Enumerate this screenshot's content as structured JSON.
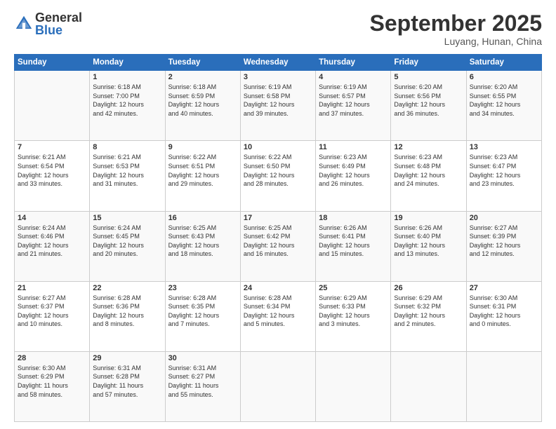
{
  "logo": {
    "general": "General",
    "blue": "Blue"
  },
  "header": {
    "month": "September 2025",
    "location": "Luyang, Hunan, China"
  },
  "weekdays": [
    "Sunday",
    "Monday",
    "Tuesday",
    "Wednesday",
    "Thursday",
    "Friday",
    "Saturday"
  ],
  "weeks": [
    [
      {
        "day": "",
        "info": ""
      },
      {
        "day": "1",
        "info": "Sunrise: 6:18 AM\nSunset: 7:00 PM\nDaylight: 12 hours\nand 42 minutes."
      },
      {
        "day": "2",
        "info": "Sunrise: 6:18 AM\nSunset: 6:59 PM\nDaylight: 12 hours\nand 40 minutes."
      },
      {
        "day": "3",
        "info": "Sunrise: 6:19 AM\nSunset: 6:58 PM\nDaylight: 12 hours\nand 39 minutes."
      },
      {
        "day": "4",
        "info": "Sunrise: 6:19 AM\nSunset: 6:57 PM\nDaylight: 12 hours\nand 37 minutes."
      },
      {
        "day": "5",
        "info": "Sunrise: 6:20 AM\nSunset: 6:56 PM\nDaylight: 12 hours\nand 36 minutes."
      },
      {
        "day": "6",
        "info": "Sunrise: 6:20 AM\nSunset: 6:55 PM\nDaylight: 12 hours\nand 34 minutes."
      }
    ],
    [
      {
        "day": "7",
        "info": "Sunrise: 6:21 AM\nSunset: 6:54 PM\nDaylight: 12 hours\nand 33 minutes."
      },
      {
        "day": "8",
        "info": "Sunrise: 6:21 AM\nSunset: 6:53 PM\nDaylight: 12 hours\nand 31 minutes."
      },
      {
        "day": "9",
        "info": "Sunrise: 6:22 AM\nSunset: 6:51 PM\nDaylight: 12 hours\nand 29 minutes."
      },
      {
        "day": "10",
        "info": "Sunrise: 6:22 AM\nSunset: 6:50 PM\nDaylight: 12 hours\nand 28 minutes."
      },
      {
        "day": "11",
        "info": "Sunrise: 6:23 AM\nSunset: 6:49 PM\nDaylight: 12 hours\nand 26 minutes."
      },
      {
        "day": "12",
        "info": "Sunrise: 6:23 AM\nSunset: 6:48 PM\nDaylight: 12 hours\nand 24 minutes."
      },
      {
        "day": "13",
        "info": "Sunrise: 6:23 AM\nSunset: 6:47 PM\nDaylight: 12 hours\nand 23 minutes."
      }
    ],
    [
      {
        "day": "14",
        "info": "Sunrise: 6:24 AM\nSunset: 6:46 PM\nDaylight: 12 hours\nand 21 minutes."
      },
      {
        "day": "15",
        "info": "Sunrise: 6:24 AM\nSunset: 6:45 PM\nDaylight: 12 hours\nand 20 minutes."
      },
      {
        "day": "16",
        "info": "Sunrise: 6:25 AM\nSunset: 6:43 PM\nDaylight: 12 hours\nand 18 minutes."
      },
      {
        "day": "17",
        "info": "Sunrise: 6:25 AM\nSunset: 6:42 PM\nDaylight: 12 hours\nand 16 minutes."
      },
      {
        "day": "18",
        "info": "Sunrise: 6:26 AM\nSunset: 6:41 PM\nDaylight: 12 hours\nand 15 minutes."
      },
      {
        "day": "19",
        "info": "Sunrise: 6:26 AM\nSunset: 6:40 PM\nDaylight: 12 hours\nand 13 minutes."
      },
      {
        "day": "20",
        "info": "Sunrise: 6:27 AM\nSunset: 6:39 PM\nDaylight: 12 hours\nand 12 minutes."
      }
    ],
    [
      {
        "day": "21",
        "info": "Sunrise: 6:27 AM\nSunset: 6:37 PM\nDaylight: 12 hours\nand 10 minutes."
      },
      {
        "day": "22",
        "info": "Sunrise: 6:28 AM\nSunset: 6:36 PM\nDaylight: 12 hours\nand 8 minutes."
      },
      {
        "day": "23",
        "info": "Sunrise: 6:28 AM\nSunset: 6:35 PM\nDaylight: 12 hours\nand 7 minutes."
      },
      {
        "day": "24",
        "info": "Sunrise: 6:28 AM\nSunset: 6:34 PM\nDaylight: 12 hours\nand 5 minutes."
      },
      {
        "day": "25",
        "info": "Sunrise: 6:29 AM\nSunset: 6:33 PM\nDaylight: 12 hours\nand 3 minutes."
      },
      {
        "day": "26",
        "info": "Sunrise: 6:29 AM\nSunset: 6:32 PM\nDaylight: 12 hours\nand 2 minutes."
      },
      {
        "day": "27",
        "info": "Sunrise: 6:30 AM\nSunset: 6:31 PM\nDaylight: 12 hours\nand 0 minutes."
      }
    ],
    [
      {
        "day": "28",
        "info": "Sunrise: 6:30 AM\nSunset: 6:29 PM\nDaylight: 11 hours\nand 58 minutes."
      },
      {
        "day": "29",
        "info": "Sunrise: 6:31 AM\nSunset: 6:28 PM\nDaylight: 11 hours\nand 57 minutes."
      },
      {
        "day": "30",
        "info": "Sunrise: 6:31 AM\nSunset: 6:27 PM\nDaylight: 11 hours\nand 55 minutes."
      },
      {
        "day": "",
        "info": ""
      },
      {
        "day": "",
        "info": ""
      },
      {
        "day": "",
        "info": ""
      },
      {
        "day": "",
        "info": ""
      }
    ]
  ]
}
